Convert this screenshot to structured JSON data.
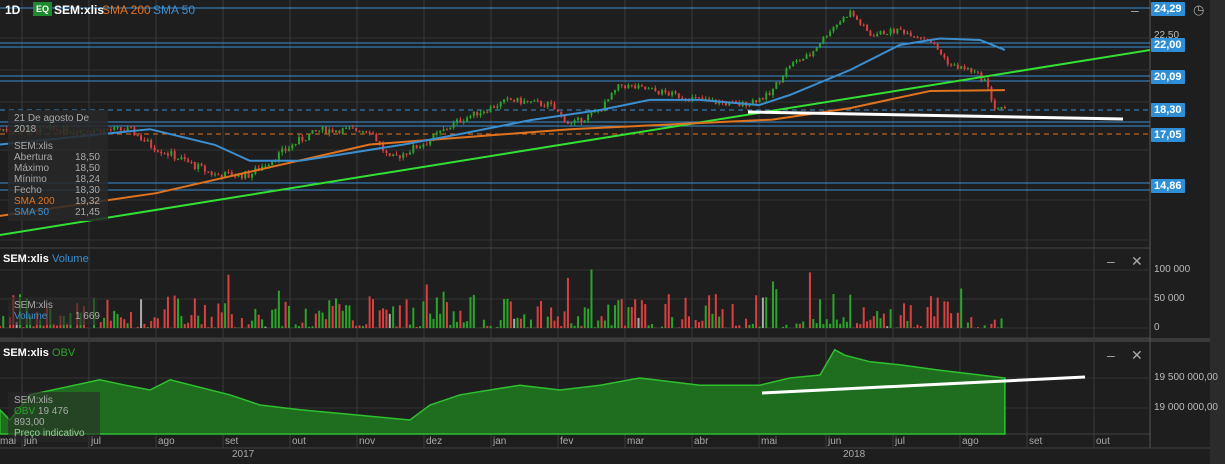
{
  "header": {
    "interval": "1D",
    "type_badge": "EQ",
    "symbol": "SEM:xlis",
    "sma200_label": "SMA 200",
    "sma50_label": "SMA 50"
  },
  "price_axis_tags": [
    "24,29",
    "22,00",
    "20,09",
    "18,30",
    "17,05",
    "14,86"
  ],
  "price_axis_hidden": "22,50",
  "tooltip": {
    "date": "21 De agosto De 2018",
    "symbol": "SEM:xlis",
    "rows": [
      {
        "label": "Abertura",
        "value": "18,50"
      },
      {
        "label": "Máximo",
        "value": "18,50"
      },
      {
        "label": "Mínimo",
        "value": "18,24"
      },
      {
        "label": "Fecho",
        "value": "18,30"
      },
      {
        "label": "SMA 200",
        "value": "19,32"
      },
      {
        "label": "SMA 50",
        "value": "21,45"
      }
    ]
  },
  "volume_pane": {
    "symbol": "SEM:xlis",
    "indicator": "Volume",
    "legend_symbol": "SEM:xlis",
    "legend_label": "Volume",
    "legend_value": "1 669",
    "axis": [
      "100 000",
      "50 000",
      "0"
    ]
  },
  "obv_pane": {
    "symbol": "SEM:xlis",
    "indicator": "OBV",
    "legend_symbol": "SEM:xlis",
    "legend_label": "OBV",
    "legend_value": "19 476 893,00",
    "legend_note": "Preço indicativo",
    "axis": [
      "19 500 000,00",
      "19 000 000,00"
    ]
  },
  "x_axis": {
    "months": [
      "mai",
      "jun",
      "jul",
      "ago",
      "set",
      "out",
      "nov",
      "dez",
      "jan",
      "fev",
      "mar",
      "abr",
      "mai",
      "jun",
      "jul",
      "ago",
      "set",
      "out"
    ],
    "years": [
      "2017",
      "2018"
    ]
  },
  "colors": {
    "up": "#2aa52a",
    "down": "#d9403f",
    "sma50": "#3b8fd0",
    "sma200": "#e0731f",
    "trend": "#33e033",
    "level": "#3b8fd0"
  },
  "chart_data": {
    "type": "candlestick",
    "time_unit": "months since 1 Jun 2017",
    "close_path": [
      [
        0.67,
        17.3
      ],
      [
        2.61,
        17.26
      ],
      [
        2.91,
        16.58
      ],
      [
        3.88,
        15.29
      ],
      [
        4.4,
        15.3
      ],
      [
        5.15,
        16.79
      ],
      [
        5.45,
        17.26
      ],
      [
        6.19,
        17.26
      ],
      [
        6.49,
        15.93
      ],
      [
        7.09,
        16.79
      ],
      [
        7.54,
        17.78
      ],
      [
        8.28,
        18.83
      ],
      [
        8.88,
        18.56
      ],
      [
        9.18,
        17.52
      ],
      [
        9.63,
        18.3
      ],
      [
        9.93,
        19.62
      ],
      [
        10.37,
        19.35
      ],
      [
        11.12,
        18.83
      ],
      [
        11.72,
        18.56
      ],
      [
        12.16,
        19.09
      ],
      [
        12.46,
        20.77
      ],
      [
        12.76,
        21.38
      ],
      [
        13.06,
        22.93
      ],
      [
        13.36,
        24.04
      ],
      [
        13.66,
        22.62
      ],
      [
        14.1,
        22.93
      ],
      [
        14.55,
        22.31
      ],
      [
        14.85,
        20.77
      ],
      [
        15.15,
        20.46
      ],
      [
        15.37,
        19.88
      ],
      [
        15.52,
        18.41
      ],
      [
        15.67,
        18.3
      ]
    ],
    "sma50": [
      [
        0.67,
        16.6
      ],
      [
        2.91,
        17.3
      ],
      [
        3.88,
        16.58
      ],
      [
        4.4,
        15.9
      ],
      [
        5.15,
        15.9
      ],
      [
        5.6,
        16.1
      ],
      [
        6.7,
        16.6
      ],
      [
        7.54,
        17.05
      ],
      [
        8.6,
        17.78
      ],
      [
        9.63,
        18.3
      ],
      [
        10.37,
        18.83
      ],
      [
        11.12,
        18.83
      ],
      [
        12.0,
        18.56
      ],
      [
        12.46,
        19.09
      ],
      [
        13.36,
        20.46
      ],
      [
        14.1,
        22.0
      ],
      [
        14.7,
        22.4
      ],
      [
        15.3,
        22.31
      ],
      [
        15.67,
        21.7
      ]
    ],
    "sma200": [
      [
        0.67,
        13.5
      ],
      [
        3.0,
        14.5
      ],
      [
        6.19,
        16.6
      ],
      [
        9.18,
        17.3
      ],
      [
        12.2,
        17.8
      ],
      [
        13.36,
        18.4
      ],
      [
        14.55,
        19.3
      ],
      [
        15.67,
        19.35
      ]
    ],
    "levels": [
      24.29,
      22.0,
      20.09,
      18.3,
      17.05,
      14.86
    ],
    "obv": [
      [
        0.67,
        18.97
      ],
      [
        0.82,
        18.8
      ],
      [
        1.12,
        19.22
      ],
      [
        2.16,
        19.47
      ],
      [
        2.54,
        19.38
      ],
      [
        2.91,
        19.3
      ],
      [
        3.21,
        19.47
      ],
      [
        4.1,
        19.22
      ],
      [
        4.55,
        19.05
      ],
      [
        5.15,
        18.97
      ],
      [
        6.04,
        18.88
      ],
      [
        6.79,
        18.8
      ],
      [
        7.09,
        19.05
      ],
      [
        7.54,
        19.22
      ],
      [
        8.43,
        19.38
      ],
      [
        9.03,
        19.3
      ],
      [
        9.63,
        19.38
      ],
      [
        10.22,
        19.5
      ],
      [
        11.12,
        19.38
      ],
      [
        12.01,
        19.38
      ],
      [
        12.46,
        19.5
      ],
      [
        12.91,
        19.55
      ],
      [
        13.13,
        19.97
      ],
      [
        13.28,
        19.88
      ],
      [
        13.66,
        19.77
      ],
      [
        14.1,
        19.72
      ],
      [
        14.7,
        19.63
      ],
      [
        15.3,
        19.55
      ],
      [
        15.67,
        19.5
      ]
    ],
    "volume_axis": [
      0,
      50000,
      100000
    ],
    "last_volume": 1669
  }
}
